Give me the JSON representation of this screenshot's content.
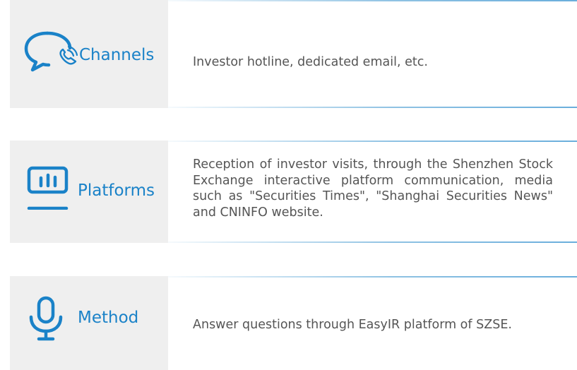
{
  "rows": [
    {
      "icon": "chat-phone-icon",
      "title": "Channels",
      "description": "Investor hotline, dedicated email, etc."
    },
    {
      "icon": "monitor-bar-chart-icon",
      "title": "Platforms",
      "description": "Reception of investor visits, through the Shenzhen Stock Exchange interactive platform communication, media such as \"Securities Times\", \"Shanghai Securities News\" and CNINFO website."
    },
    {
      "icon": "microphone-icon",
      "title": "Method",
      "description": "Answer questions through EasyIR platform of SZSE."
    }
  ],
  "colors": {
    "accent": "#1a82c8",
    "panel_bg": "#efefef",
    "text": "#555555",
    "divider": "#8fc2e3"
  }
}
